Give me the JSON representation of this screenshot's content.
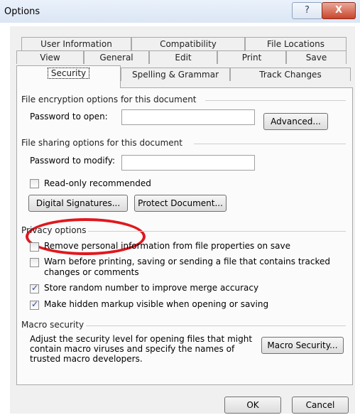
{
  "window": {
    "title": "Options",
    "help_label": "?",
    "close_label": "X"
  },
  "tabs": {
    "row1": [
      "User Information",
      "Compatibility",
      "File Locations"
    ],
    "row2": [
      "View",
      "General",
      "Edit",
      "Print",
      "Save"
    ],
    "row3": [
      "Security",
      "Spelling & Grammar",
      "Track Changes"
    ],
    "active": "Security"
  },
  "encryption": {
    "heading": "File encryption options for this document",
    "password_open_label": "Password to open:",
    "password_open_value": "",
    "advanced_button": "Advanced..."
  },
  "sharing": {
    "heading": "File sharing options for this document",
    "password_modify_label": "Password to modify:",
    "password_modify_value": "",
    "readonly_label": "Read-only recommended",
    "readonly_checked": false,
    "digital_signatures_button": "Digital Signatures...",
    "protect_document_button": "Protect Document..."
  },
  "privacy": {
    "heading": "Privacy options",
    "options": [
      {
        "label": "Remove personal information from file properties on save",
        "checked": false
      },
      {
        "label": "Warn before printing, saving or sending a file that contains tracked",
        "label2": "changes or comments",
        "checked": false
      },
      {
        "label": "Store random number to improve merge accuracy",
        "checked": true
      },
      {
        "label": "Make hidden markup visible when opening or saving",
        "checked": true
      }
    ]
  },
  "macro": {
    "heading": "Macro security",
    "description_lines": [
      "Adjust the security level for opening files that might",
      "contain macro viruses and specify the names of",
      "trusted macro developers."
    ],
    "button": "Macro Security..."
  },
  "footer": {
    "ok": "OK",
    "cancel": "Cancel"
  },
  "colors": {
    "highlight_circle": "#e0181e",
    "checkmark": "#2a4a9a"
  }
}
